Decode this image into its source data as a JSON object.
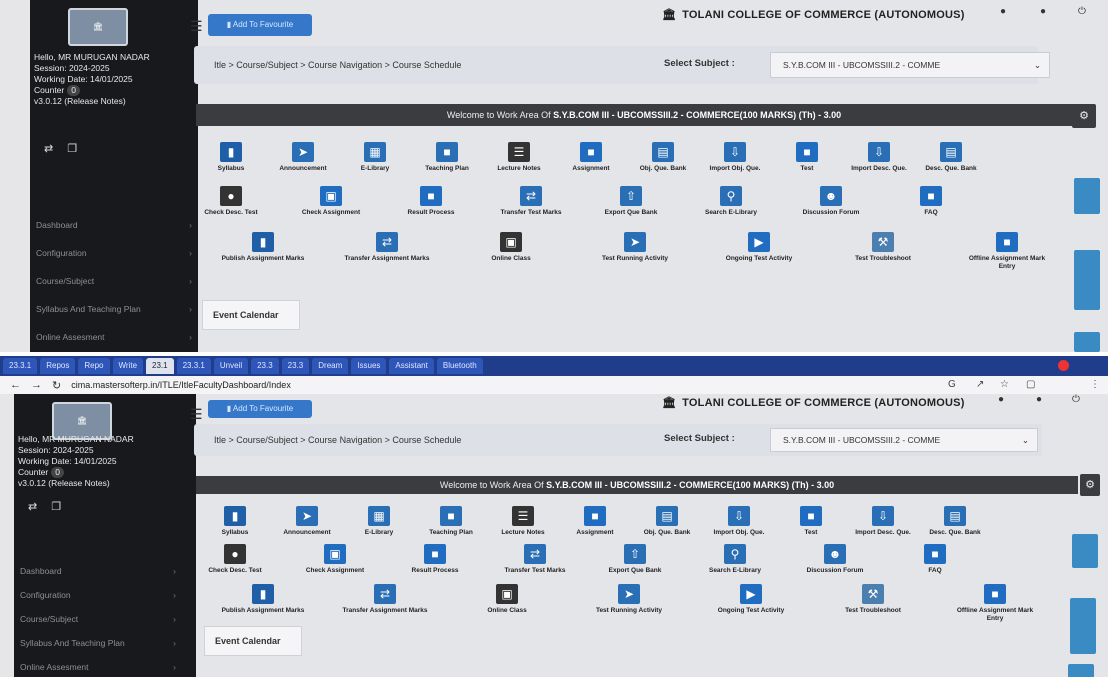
{
  "browser": {
    "tabs": [
      "23.3.1",
      "Repos",
      "Repo",
      "Write",
      "23.1",
      "23.3.1",
      "Unveil",
      "23.3",
      "23.3",
      "Dream",
      "Issues",
      "Assistant",
      "Bluetooth"
    ],
    "url": "cima.mastersofterp.in/ITLE/ItleFacultyDashboard/Index"
  },
  "app": {
    "college_name": "TOLANI COLLEGE OF COMMERCE (AUTONOMOUS)",
    "add_favourite": "Add To Favourite",
    "user": {
      "greeting": "Hello, MR MURUGAN NADAR",
      "session": "Session: 2024-2025",
      "working_date": "Working Date: 14/01/2025",
      "counter_label": "Counter",
      "counter_value": "0",
      "version": "v3.0.12 (Release Notes)"
    },
    "menu": [
      "Dashboard",
      "Configuration",
      "Course/Subject",
      "Syllabus And Teaching Plan",
      "Online Assesment"
    ],
    "breadcrumb": "Itle > Course/Subject > Course Navigation > Course Schedule",
    "select_subject_label": "Select Subject :",
    "selected_subject": "S.Y.B.COM III - UBCOMSSIII.2 - COMME",
    "welcome_prefix": "Welcome to Work Area Of",
    "welcome_subject": "S.Y.B.COM III - UBCOMSSIII.2 - COMMERCE(100 MARKS) (Th) - 3.00",
    "tiles": [
      {
        "label": "Syllabus",
        "icon": "book-icon",
        "color": "#1f5fa8"
      },
      {
        "label": "Announcement",
        "icon": "megaphone-icon",
        "color": "#2a6fb5"
      },
      {
        "label": "E-Library",
        "icon": "library-icon",
        "color": "#2a6fb5"
      },
      {
        "label": "Teaching Plan",
        "icon": "teacher-icon",
        "color": "#2a6fb5"
      },
      {
        "label": "Lecture Notes",
        "icon": "notes-icon",
        "color": "#333333"
      },
      {
        "label": "Assignment",
        "icon": "assignment-icon",
        "color": "#1f6cc0"
      },
      {
        "label": "Obj. Que. Bank",
        "icon": "database-icon",
        "color": "#2a6fb5"
      },
      {
        "label": "Import Obj. Que.",
        "icon": "import-icon",
        "color": "#2a6fb5"
      },
      {
        "label": "Test",
        "icon": "test-icon",
        "color": "#1f6cc0"
      },
      {
        "label": "Import Desc. Que.",
        "icon": "import-icon",
        "color": "#2a6fb5"
      },
      {
        "label": "Desc. Que. Bank",
        "icon": "database-icon",
        "color": "#2a6fb5"
      },
      {
        "label": "Check Desc. Test",
        "icon": "user-check-icon",
        "color": "#333333"
      },
      {
        "label": "Check Assignment",
        "icon": "monitor-check-icon",
        "color": "#1f6cc0"
      },
      {
        "label": "Result Process",
        "icon": "result-icon",
        "color": "#1f6cc0"
      },
      {
        "label": "Transfer Test Marks",
        "icon": "transfer-icon",
        "color": "#2a6fb5"
      },
      {
        "label": "Export Que Bank",
        "icon": "export-icon",
        "color": "#2a6fb5"
      },
      {
        "label": "Search E-Library",
        "icon": "search-library-icon",
        "color": "#2a6fb5"
      },
      {
        "label": "Discussion Forum",
        "icon": "forum-icon",
        "color": "#2a6fb5"
      },
      {
        "label": "FAQ",
        "icon": "faq-icon",
        "color": "#1f6cc0"
      },
      {
        "label": "Publish Assignment Marks",
        "icon": "publish-icon",
        "color": "#1f5fa8"
      },
      {
        "label": "Transfer Assignment Marks",
        "icon": "transfer-icon",
        "color": "#2a6fb5"
      },
      {
        "label": "Online Class",
        "icon": "online-class-icon",
        "color": "#333333"
      },
      {
        "label": "Test Running Activity",
        "icon": "activity-icon",
        "color": "#2a6fb5"
      },
      {
        "label": "Ongoing Test Activity",
        "icon": "ongoing-icon",
        "color": "#1f6cc0"
      },
      {
        "label": "Test Troubleshoot",
        "icon": "troubleshoot-icon",
        "color": "#4a7fb0"
      },
      {
        "label": "Offline Assignment Mark Entry",
        "icon": "mark-entry-icon",
        "color": "#1f6cc0"
      }
    ],
    "event_calendar": "Event Calendar"
  }
}
